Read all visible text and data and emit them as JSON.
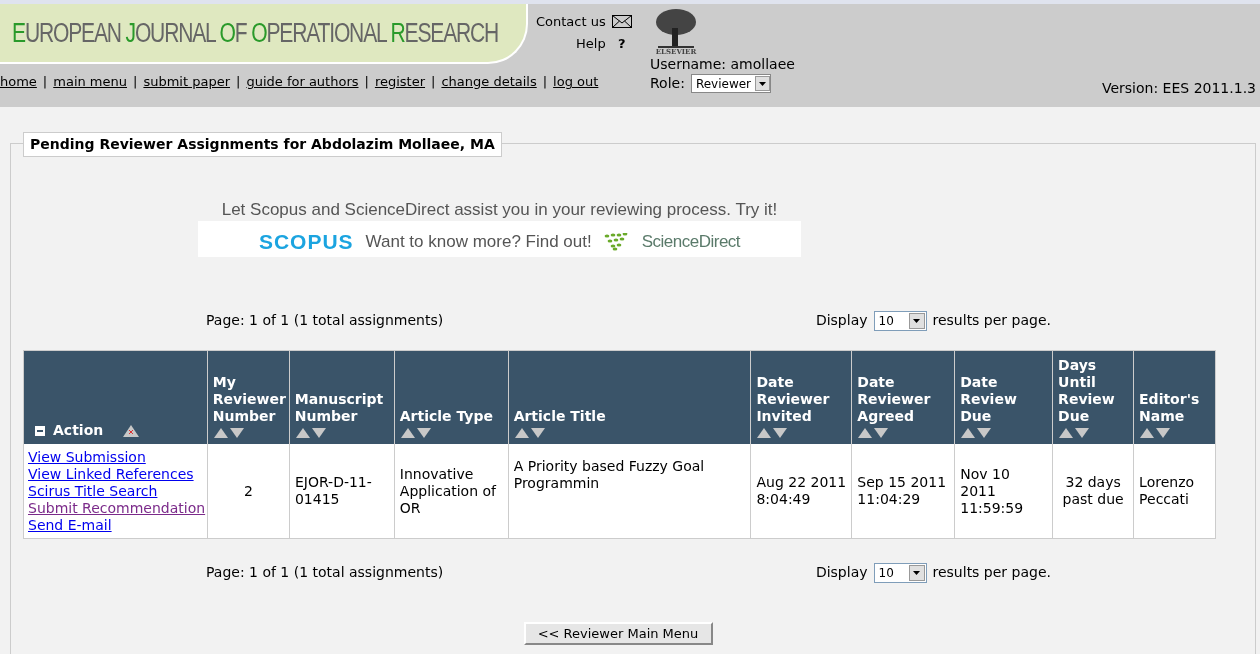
{
  "header": {
    "journal_words": [
      "EUROPEAN",
      "JOURNAL",
      "OF",
      "OPERATIONAL",
      "RESEARCH"
    ],
    "links": [
      {
        "label": "Contact us"
      },
      {
        "label": "Help",
        "symbol": "?"
      }
    ],
    "nav_separator": "|",
    "publisher": "ELSEVIER",
    "nav": [
      "home",
      "main menu",
      "submit paper",
      "guide for authors",
      "register",
      "change details",
      "log out"
    ],
    "username": "Username: amollaee",
    "role_label": "Role:",
    "role_value": "Reviewer",
    "version": "Version: EES 2011.1.3"
  },
  "panel": {
    "title": "Pending Reviewer Assignments for Abdolazim Mollaee, MA",
    "ad": {
      "headline": "Let Scopus and ScienceDirect assist you in your reviewing process. Try it!",
      "scopus": "SCOPUS",
      "middle": "Want to know more? Find out!",
      "sciencedirect": "ScienceDirect"
    },
    "pager_top": {
      "page": "Page: 1 of 1 (1 total assignments)",
      "display": "Display",
      "per_page": "10",
      "suffix": "results per page."
    },
    "table": {
      "columns": [
        "Action",
        "My Reviewer Number",
        "Manuscript Number",
        "Article Type",
        "Article Title",
        "Date Reviewer Invited",
        "Date Reviewer Agreed",
        "Date Review Due",
        "Days Until Review Due",
        "Editor's Name"
      ],
      "rows": [
        {
          "cells": [
            [
              {
                "label": "View Submission",
                "visited": false
              },
              {
                "label": "View Linked References",
                "visited": false
              },
              {
                "label": "Scirus Title Search",
                "visited": false
              },
              {
                "label": "Submit Recommendation",
                "visited": true
              },
              {
                "label": "Send E-mail",
                "visited": false
              }
            ],
            "2",
            "EJOR-D-11-01415",
            "Innovative Application of OR",
            "A Priority based Fuzzy Goal Programmin",
            "Aug 22 2011 8:04:49",
            "Sep 15 2011 11:04:29",
            "Nov 10 2011 11:59:59",
            "32 days past due",
            "Lorenzo Peccati"
          ]
        }
      ]
    },
    "pager_bottom": {
      "page": "Page: 1 of 1 (1 total assignments)",
      "display": "Display",
      "per_page": "10",
      "suffix": "results per page."
    },
    "back_button": "<< Reviewer Main Menu"
  }
}
